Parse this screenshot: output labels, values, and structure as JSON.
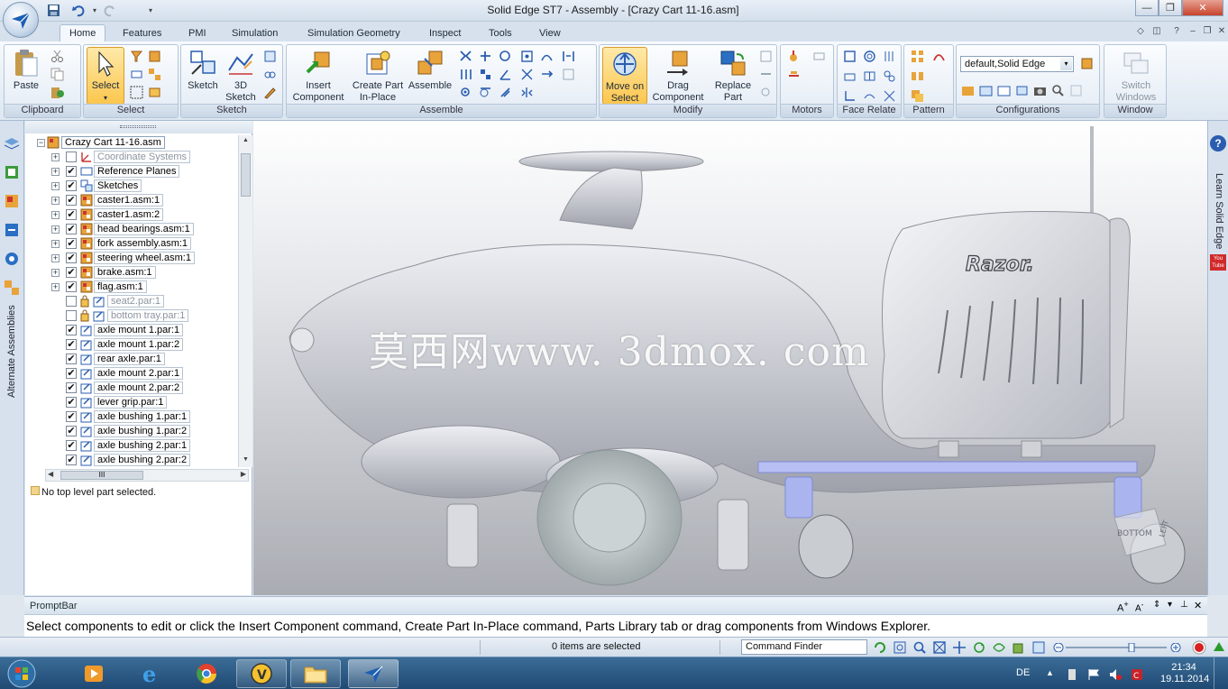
{
  "window": {
    "title": "Solid Edge ST7 - Assembly - [Crazy Cart 11-16.asm]",
    "controls": [
      "minimize",
      "restore",
      "close"
    ]
  },
  "ribbon": {
    "tabs": [
      {
        "label": "Home",
        "active": true
      },
      {
        "label": "Features"
      },
      {
        "label": "PMI"
      },
      {
        "label": "Simulation"
      },
      {
        "label": "Simulation Geometry"
      },
      {
        "label": "Inspect"
      },
      {
        "label": "Tools"
      },
      {
        "label": "View"
      }
    ],
    "groups": {
      "clipboard": {
        "label": "Clipboard",
        "paste": "Paste"
      },
      "select": {
        "label": "Select",
        "select": "Select"
      },
      "sketch": {
        "label": "Sketch",
        "sketch": "Sketch",
        "sketch3d_line1": "3D",
        "sketch3d_line2": "Sketch"
      },
      "assemble": {
        "label": "Assemble",
        "insert_line1": "Insert",
        "insert_line2": "Component",
        "create_line1": "Create Part",
        "create_line2": "In-Place",
        "assemble": "Assemble"
      },
      "modify": {
        "label": "Modify",
        "move_line1": "Move on",
        "move_line2": "Select",
        "drag_line1": "Drag",
        "drag_line2": "Component",
        "replace_line1": "Replace",
        "replace_line2": "Part"
      },
      "motors": {
        "label": "Motors"
      },
      "face_relate": {
        "label": "Face Relate"
      },
      "pattern": {
        "label": "Pattern"
      },
      "configurations": {
        "label": "Configurations",
        "combo_value": "default,Solid Edge"
      },
      "window": {
        "label": "Window",
        "switch_line1": "Switch",
        "switch_line2": "Windows"
      }
    }
  },
  "sidebar": {
    "alternate_assemblies": "Alternate Assemblies"
  },
  "tree": {
    "root": "Crazy Cart 11-16.asm",
    "items": [
      {
        "label": "Coordinate Systems",
        "expand": "+",
        "checked": false,
        "dim": true,
        "icon": "coord-icon"
      },
      {
        "label": "Reference Planes",
        "expand": "+",
        "checked": true,
        "icon": "plane-icon"
      },
      {
        "label": "Sketches",
        "expand": "+",
        "checked": true,
        "icon": "sketch-icon"
      },
      {
        "label": "caster1.asm:1",
        "expand": "+",
        "checked": true,
        "icon": "asm-icon"
      },
      {
        "label": "caster1.asm:2",
        "expand": "+",
        "checked": true,
        "icon": "asm-icon"
      },
      {
        "label": "head bearings.asm:1",
        "expand": "+",
        "checked": true,
        "icon": "asm-icon"
      },
      {
        "label": "fork assembly.asm:1",
        "expand": "+",
        "checked": true,
        "icon": "asm-icon"
      },
      {
        "label": "steering wheel.asm:1",
        "expand": "+",
        "checked": true,
        "icon": "asm-icon"
      },
      {
        "label": "brake.asm:1",
        "expand": "+",
        "checked": true,
        "icon": "asm-icon"
      },
      {
        "label": "flag.asm:1",
        "expand": "+",
        "checked": true,
        "icon": "asm-icon"
      },
      {
        "label": "seat2.par:1",
        "expand": "",
        "checked": false,
        "dim": true,
        "icon": "part-lock-icon"
      },
      {
        "label": "bottom tray.par:1",
        "expand": "",
        "checked": false,
        "dim": true,
        "icon": "part-lock-icon"
      },
      {
        "label": "axle mount 1.par:1",
        "expand": "",
        "checked": true,
        "icon": "part-icon"
      },
      {
        "label": "axle mount 1.par:2",
        "expand": "",
        "checked": true,
        "icon": "part-icon"
      },
      {
        "label": "rear axle.par:1",
        "expand": "",
        "checked": true,
        "icon": "part-icon"
      },
      {
        "label": "axle mount 2.par:1",
        "expand": "",
        "checked": true,
        "icon": "part-icon"
      },
      {
        "label": "axle mount 2.par:2",
        "expand": "",
        "checked": true,
        "icon": "part-icon"
      },
      {
        "label": "lever grip.par:1",
        "expand": "",
        "checked": true,
        "icon": "part-icon"
      },
      {
        "label": "axle bushing 1.par:1",
        "expand": "",
        "checked": true,
        "icon": "part-icon"
      },
      {
        "label": "axle bushing 1.par:2",
        "expand": "",
        "checked": true,
        "icon": "part-icon"
      },
      {
        "label": "axle bushing 2.par:1",
        "expand": "",
        "checked": true,
        "icon": "part-icon"
      },
      {
        "label": "axle bushing 2.par:2",
        "expand": "",
        "checked": true,
        "icon": "part-icon"
      }
    ],
    "hscroll_label": "III",
    "status": "No top level part selected."
  },
  "viewport": {
    "watermark": "莫西网www. 3dmox. com",
    "brand_logo": "Razor.",
    "view_cube_label": "BOTTOM",
    "view_cube_side": "LEFT"
  },
  "right_panel": {
    "learn": "Learn Solid Edge",
    "youtube": "You Tube"
  },
  "promptbar": {
    "title": "PromptBar",
    "message": "Select components to edit or click the Insert Component command, Create Part In-Place command, Parts Library tab or drag components from Windows Explorer."
  },
  "statusbar": {
    "selection": "0 items are selected",
    "command_finder": "Command Finder"
  },
  "taskbar": {
    "language": "DE",
    "time": "21:34",
    "date": "19.11.2014",
    "apps": [
      "media-player-icon",
      "internet-explorer-icon",
      "chrome-icon",
      "app-v-icon",
      "explorer-folder-icon",
      "solid-edge-icon"
    ]
  },
  "colors": {
    "accent": "#fbc64e",
    "ribbon_bg": "#dde7f1",
    "taskbar": "#1f4a73",
    "model_gray": "#c9cbd2",
    "model_blue": "#aab4ee"
  }
}
